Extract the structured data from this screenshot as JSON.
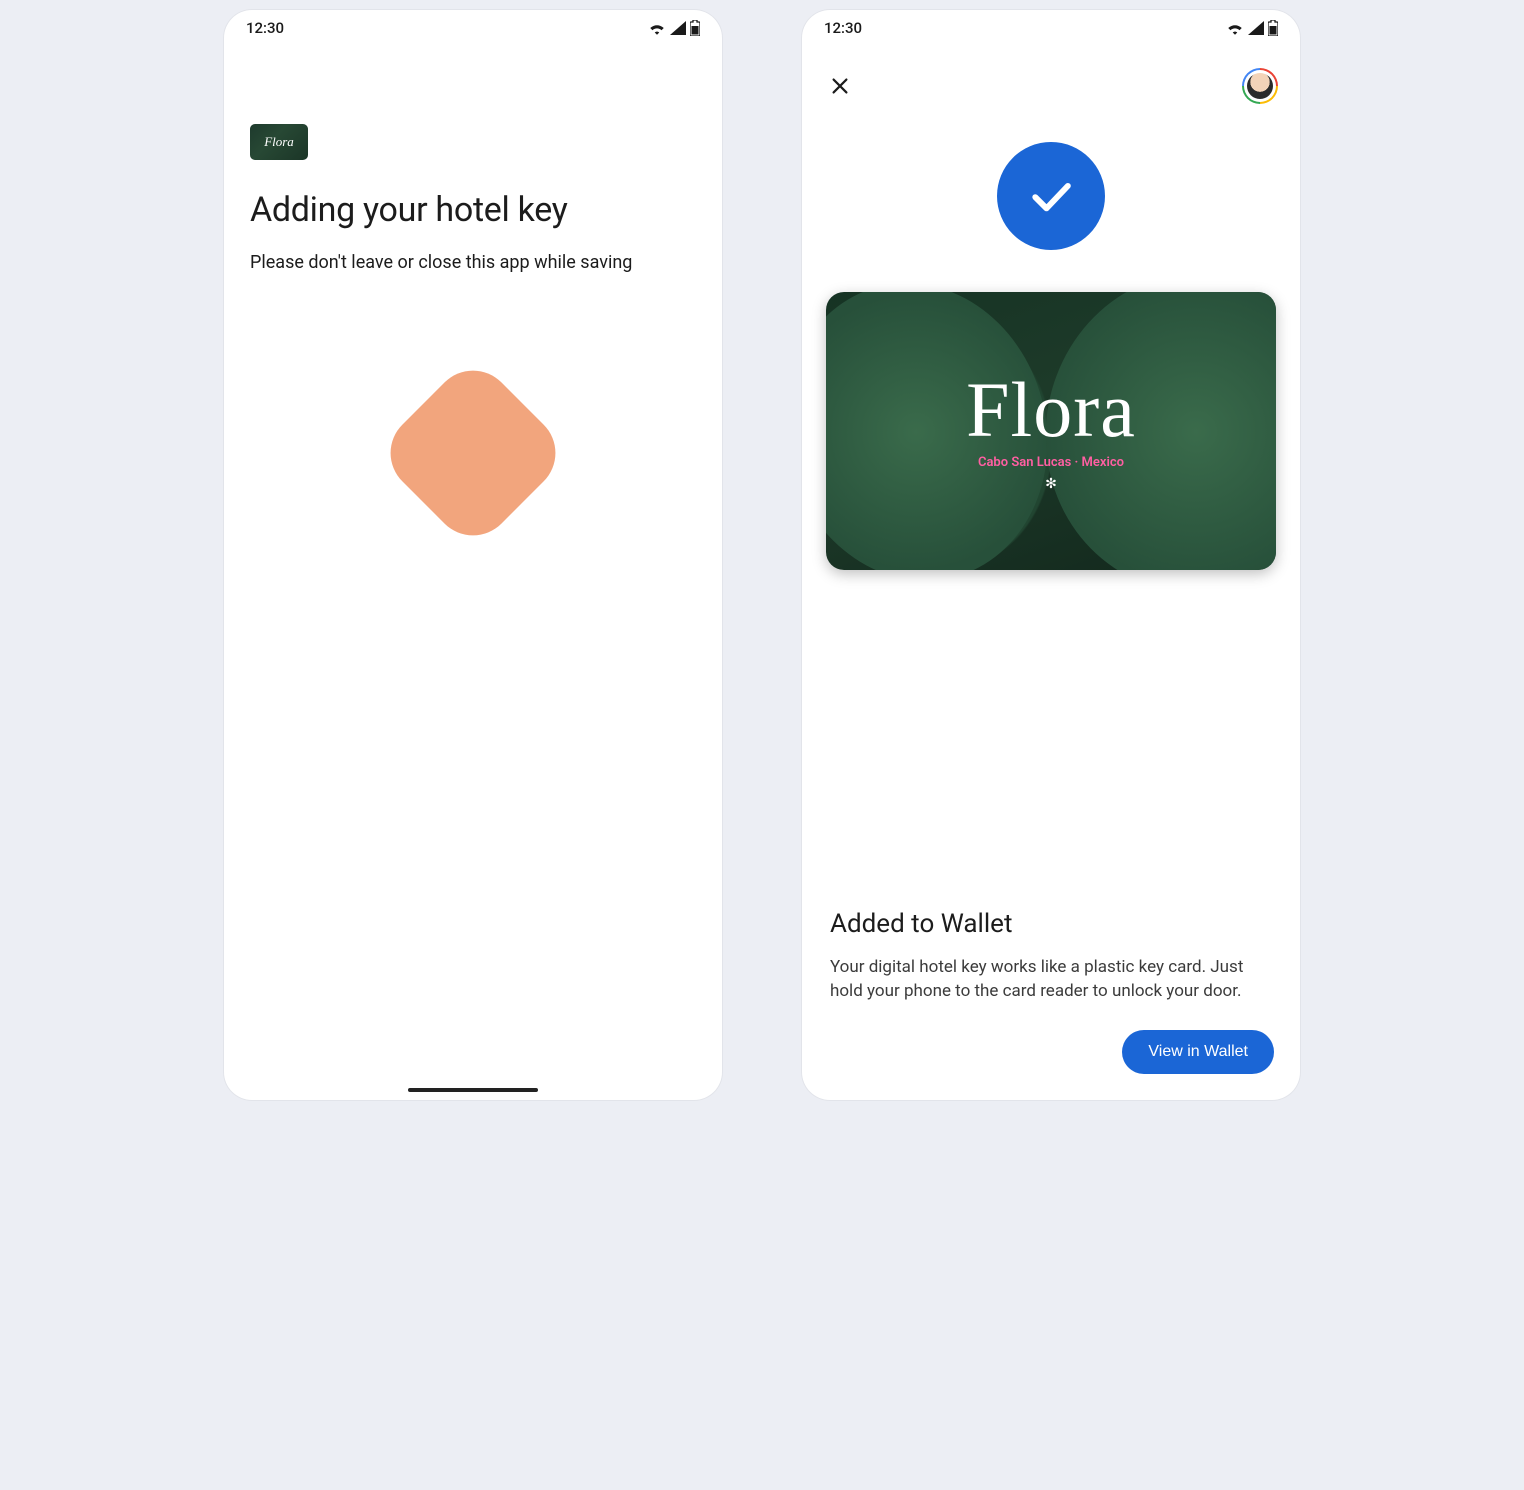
{
  "status": {
    "time": "12:30"
  },
  "left": {
    "brand_mini": "Flora",
    "title": "Adding your hotel key",
    "subtitle": "Please don't leave or close this app while saving"
  },
  "right": {
    "card": {
      "brand": "Flora",
      "subtitle": "Cabo San Lucas · Mexico"
    },
    "added_title": "Added to Wallet",
    "added_desc": "Your digital hotel key works like a plastic key card. Just hold your phone to the card reader to unlock your door.",
    "view_button": "View in Wallet"
  }
}
